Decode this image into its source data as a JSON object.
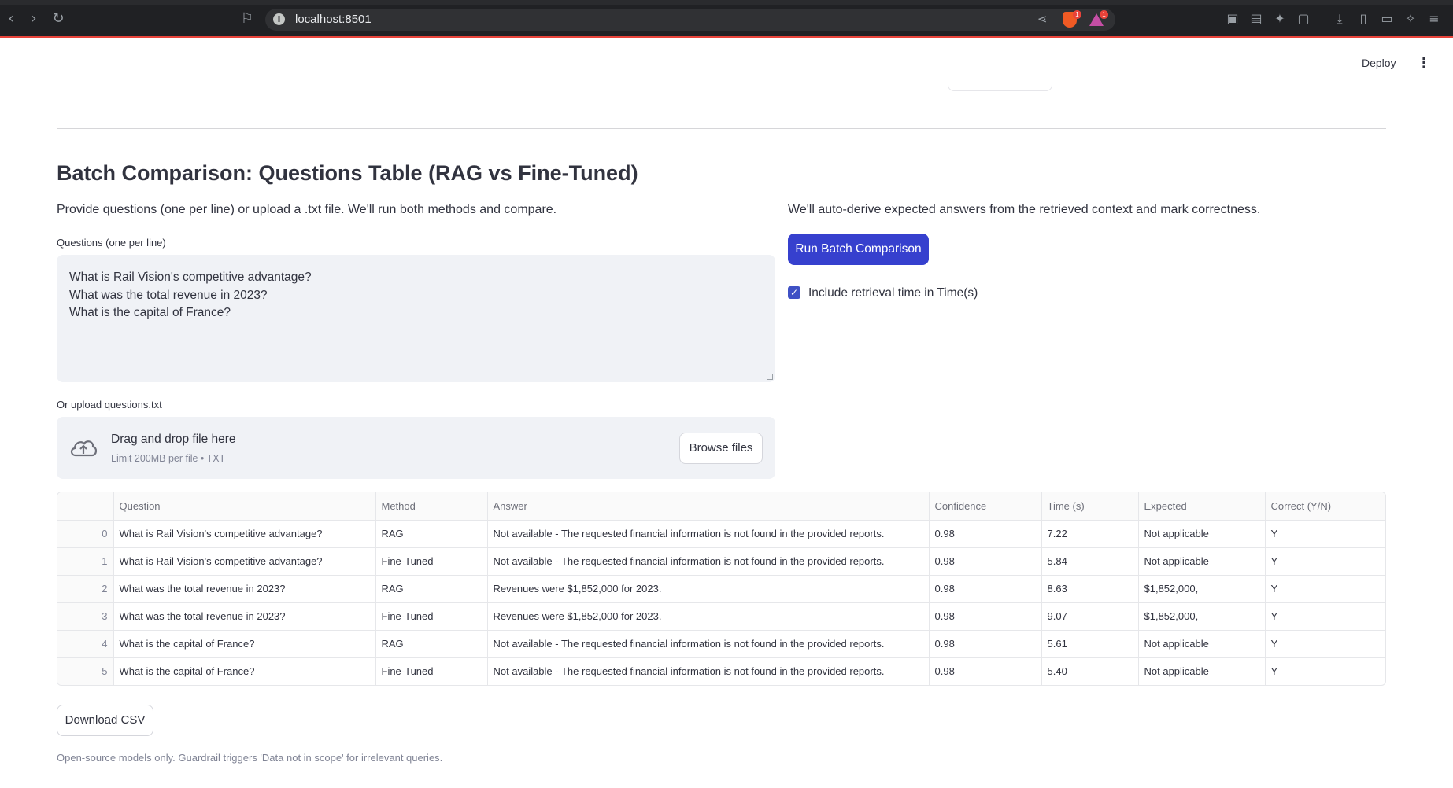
{
  "browser": {
    "url": "localhost:8501",
    "badges": [
      "1",
      "1"
    ]
  },
  "header": {
    "deploy_label": "Deploy",
    "menu_icon": "kebab-menu-icon"
  },
  "main": {
    "title": "Batch Comparison: Questions Table (RAG vs Fine-Tuned)",
    "left_description": "Provide questions (one per line) or upload a .txt file. We'll run both methods and compare.",
    "right_description": "We'll auto-derive expected answers from the retrieved context and mark correctness.",
    "questions_label": "Questions (one per line)",
    "questions": [
      "What is Rail Vision's competitive advantage?",
      "What was the total revenue in 2023?",
      "What is the capital of France?"
    ],
    "run_button": "Run Batch Comparison",
    "include_retrieval_label": "Include retrieval time in Time(s)",
    "include_retrieval_checked": true,
    "upload_label": "Or upload questions.txt",
    "uploader": {
      "drag_text": "Drag and drop file here",
      "limit_text": "Limit 200MB per file • TXT",
      "browse_button": "Browse files"
    },
    "table": {
      "columns": [
        "",
        "Question",
        "Method",
        "Answer",
        "Confidence",
        "Time (s)",
        "Expected",
        "Correct (Y/N)"
      ],
      "rows": [
        [
          "0",
          "What is Rail Vision's competitive advantage?",
          "RAG",
          "Not available - The requested financial information is not found in the provided reports.",
          "0.98",
          "7.22",
          "Not applicable",
          "Y"
        ],
        [
          "1",
          "What is Rail Vision's competitive advantage?",
          "Fine-Tuned",
          "Not available - The requested financial information is not found in the provided reports.",
          "0.98",
          "5.84",
          "Not applicable",
          "Y"
        ],
        [
          "2",
          "What was the total revenue in 2023?",
          "RAG",
          "Revenues were $1,852,000 for 2023.",
          "0.98",
          "8.63",
          "$1,852,000,",
          "Y"
        ],
        [
          "3",
          "What was the total revenue in 2023?",
          "Fine-Tuned",
          "Revenues were $1,852,000 for 2023.",
          "0.98",
          "9.07",
          "$1,852,000,",
          "Y"
        ],
        [
          "4",
          "What is the capital of France?",
          "RAG",
          "Not available - The requested financial information is not found in the provided reports.",
          "0.98",
          "5.61",
          "Not applicable",
          "Y"
        ],
        [
          "5",
          "What is the capital of France?",
          "Fine-Tuned",
          "Not available - The requested financial information is not found in the provided reports.",
          "0.98",
          "5.40",
          "Not applicable",
          "Y"
        ]
      ]
    },
    "download_button": "Download CSV",
    "caption": "Open-source models only. Guardrail triggers 'Data not in scope' for irrelevant queries."
  },
  "colors": {
    "primary": "#3640ce",
    "checkbox": "#3f51c5",
    "input_bg": "#f0f2f6",
    "chrome_bg": "#202124"
  }
}
